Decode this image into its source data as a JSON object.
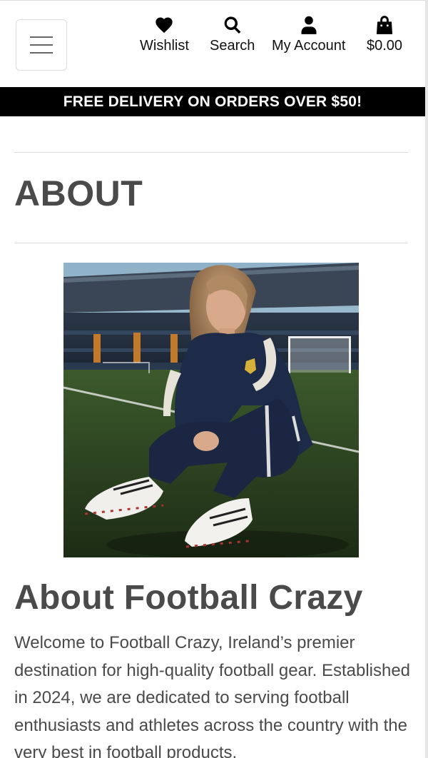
{
  "header": {
    "menu_label": "Menu",
    "nav": {
      "wishlist": "Wishlist",
      "search": "Search",
      "account": "My Account",
      "bag_total": "$0.00"
    }
  },
  "banner": {
    "text": "FREE DELIVERY ON ORDERS OVER $50!"
  },
  "page": {
    "title": "ABOUT"
  },
  "about": {
    "heading": "About Football Crazy",
    "paragraph": "Welcome to Football Crazy, Ireland’s premier destination for high-quality football gear. Established in 2024, we are dedicated to serving football enthusiasts and athletes across the country with the very best in football products."
  },
  "icons": {
    "wishlist": "heart-icon",
    "search": "search-icon",
    "account": "user-icon",
    "bag": "shopping-bag-icon",
    "menu": "hamburger-icon"
  },
  "colors": {
    "banner_bg": "#000000",
    "banner_text": "#ffffff",
    "heading_text": "#4a4a4a"
  }
}
